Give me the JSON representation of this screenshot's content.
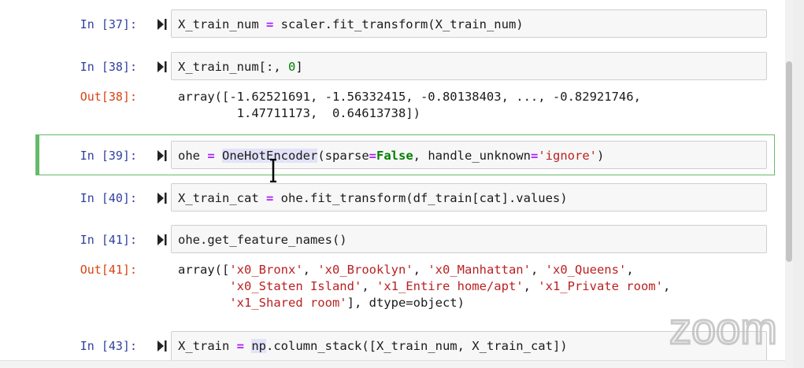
{
  "cells": [
    {
      "prompt": "In [37]:",
      "code": "X_train_num = scaler.fit_transform(X_train_num)"
    },
    {
      "prompt": "In [38]:",
      "code": "X_train_num[:, 0]",
      "out_prompt": "Out[38]:",
      "output": [
        "array([-1.62521691, -1.56332415, -0.80138403, ..., -0.82921746,",
        "        1.47711173,  0.64613738])"
      ]
    },
    {
      "prompt": "In [39]:",
      "code_parts": {
        "a": "ohe",
        "eq": " = ",
        "cls": "OneHotEncoder",
        "b": "(sparse",
        "eq2": "=",
        "kw": "False",
        "c": ", handle_unknown",
        "eq3": "=",
        "str": "'ignore'",
        "d": ")"
      }
    },
    {
      "prompt": "In [40]:",
      "code": "X_train_cat = ohe.fit_transform(df_train[cat].values)"
    },
    {
      "prompt": "In [41]:",
      "code": "ohe.get_feature_names()",
      "out_prompt": "Out[41]:",
      "output": [
        "array(['x0_Bronx', 'x0_Brooklyn', 'x0_Manhattan', 'x0_Queens',",
        "       'x0_Staten Island', 'x1_Entire home/apt', 'x1_Private room',",
        "       'x1_Shared room'], dtype=object)"
      ]
    },
    {
      "prompt": "In [43]:",
      "code": "X_train = np.column_stack([X_train_num, X_train_cat])"
    }
  ],
  "watermark": "zoom",
  "colors": {
    "in_prompt": "#303f9f",
    "out_prompt": "#d84315",
    "selected_border": "#66bb6a"
  }
}
